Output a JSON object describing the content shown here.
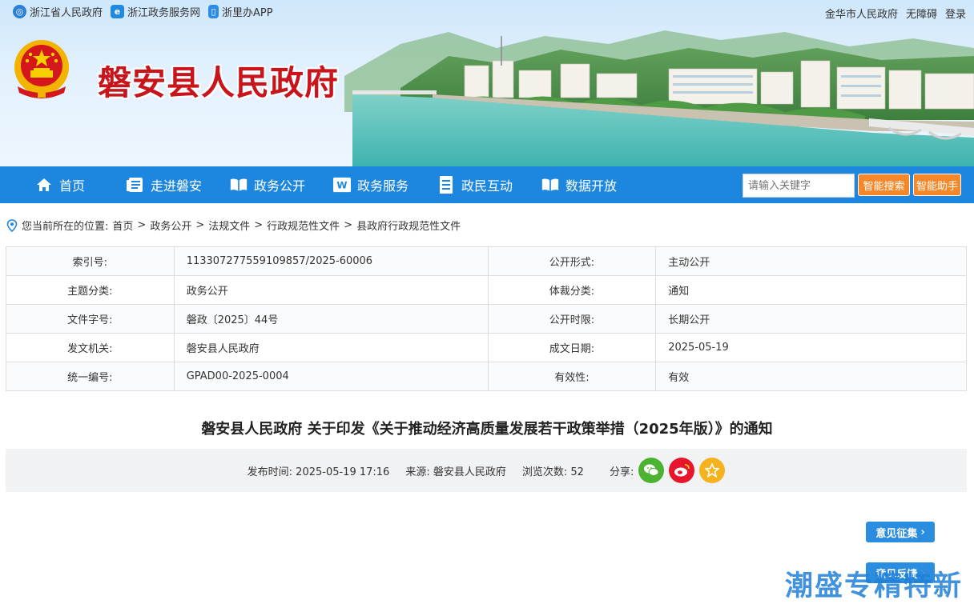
{
  "top_links": [
    {
      "label": "浙江省人民政府",
      "icon": "zhejiang-gov-icon"
    },
    {
      "label": "浙江政务服务网",
      "icon": "zj-service-icon"
    },
    {
      "label": "浙里办APP",
      "icon": "mobile-app-icon"
    }
  ],
  "right_links": [
    "金华市人民政府",
    "无障碍",
    "登录"
  ],
  "site_title": "磐安县人民政府",
  "nav": [
    {
      "label": "首页",
      "icon": "home-icon"
    },
    {
      "label": "走进磐安",
      "icon": "document-list-icon"
    },
    {
      "label": "政务公开",
      "icon": "open-book-icon"
    },
    {
      "label": "政务服务",
      "icon": "w-badge-icon"
    },
    {
      "label": "政民互动",
      "icon": "notebook-icon"
    },
    {
      "label": "数据开放",
      "icon": "data-book-icon"
    }
  ],
  "search": {
    "placeholder": "请输入关键字",
    "smart_search": "智能搜索",
    "smart_assistant": "智能助手"
  },
  "breadcrumb": {
    "prefix": "您当前所在的位置:",
    "items": [
      "首页",
      "政务公开",
      "法规文件",
      "行政规范性文件",
      "县政府行政规范性文件"
    ]
  },
  "meta": [
    {
      "l1": "索引号:",
      "v1": "113307277559109857/2025-60006",
      "l2": "公开形式:",
      "v2": "主动公开"
    },
    {
      "l1": "主题分类:",
      "v1": "政务公开",
      "l2": "体裁分类:",
      "v2": "通知"
    },
    {
      "l1": "文件字号:",
      "v1": "磐政〔2025〕44号",
      "l2": "公开时限:",
      "v2": "长期公开"
    },
    {
      "l1": "发文机关:",
      "v1": "磐安县人民政府",
      "l2": "成文日期:",
      "v2": "2025-05-19"
    },
    {
      "l1": "统一编号:",
      "v1": "GPAD00-2025-0004",
      "l2": "有效性:",
      "v2": "有效"
    }
  ],
  "article": {
    "title": "磐安县人民政府 关于印发《关于推动经济高质量发展若干政策举措（2025年版）》的通知",
    "publish_label": "发布时间:",
    "publish_time": "2025-05-19 17:16",
    "source_label": "来源:",
    "source": "磐安县人民政府",
    "views_label": "浏览次数:",
    "views": "52",
    "share_label": "分享:"
  },
  "side": {
    "opinion_collect": "意见征集",
    "feedback": "意见反馈"
  },
  "watermark": "潮盛专精特新",
  "colors": {
    "nav_blue": "#1d87e0",
    "title_red": "#c8141b",
    "orange": "#f7882a",
    "wechat": "#4cb232",
    "weibo": "#e6162d",
    "favorite": "#f5b21f"
  }
}
